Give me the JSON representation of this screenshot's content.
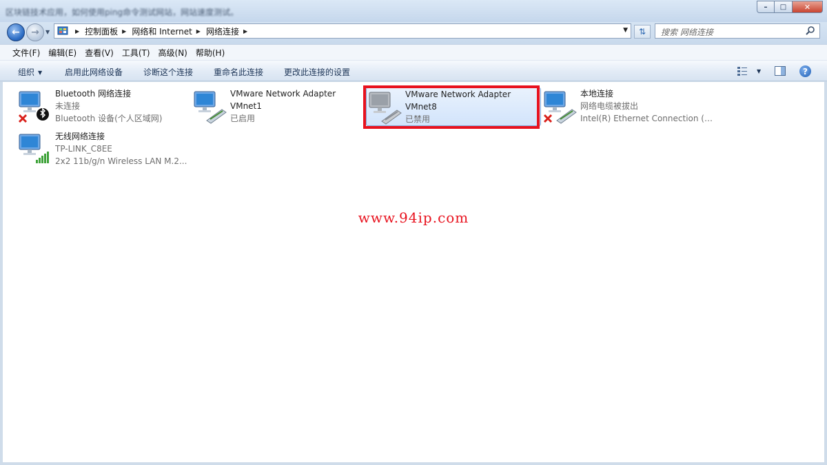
{
  "window": {
    "title": "",
    "title_blurred": "区块链技术应用，如何使用ping命令测试网站，网站速度测试。",
    "colors": {
      "highlight": "#e8121e",
      "selection": "#d2e4fb"
    }
  },
  "address": {
    "crumbs": [
      "控制面板",
      "网络和 Internet",
      "网络连接"
    ],
    "search_placeholder": "搜索 网络连接"
  },
  "menu": {
    "items": [
      "文件(F)",
      "编辑(E)",
      "查看(V)",
      "工具(T)",
      "高级(N)",
      "帮助(H)"
    ]
  },
  "commands": {
    "organize": "组织",
    "enable": "启用此网络设备",
    "diagnose": "诊断这个连接",
    "rename": "重命名此连接",
    "change": "更改此连接的设置"
  },
  "connections": [
    {
      "name": "Bluetooth 网络连接",
      "line2": "未连接",
      "line3": "Bluetooth 设备(个人区域网)",
      "icon": "bluetooth-network-icon",
      "status": "disconnected"
    },
    {
      "name": "VMware Network Adapter",
      "line2": "VMnet1",
      "line3": "已启用",
      "icon": "wired-adapter-icon",
      "status": "enabled"
    },
    {
      "name": "VMware Network Adapter",
      "line2": "VMnet8",
      "line3": "已禁用",
      "icon": "wired-adapter-icon",
      "status": "disabled"
    },
    {
      "name": "本地连接",
      "line2": "网络电缆被拔出",
      "line3": "Intel(R) Ethernet Connection (3...",
      "icon": "wired-adapter-icon",
      "status": "unplugged"
    },
    {
      "name": "无线网络连接",
      "line2": "TP-LINK_C8EE",
      "line3": "2x2 11b/g/n Wireless LAN M.2...",
      "icon": "wireless-adapter-icon",
      "status": "connected"
    }
  ],
  "watermark": "www.94ip.com"
}
